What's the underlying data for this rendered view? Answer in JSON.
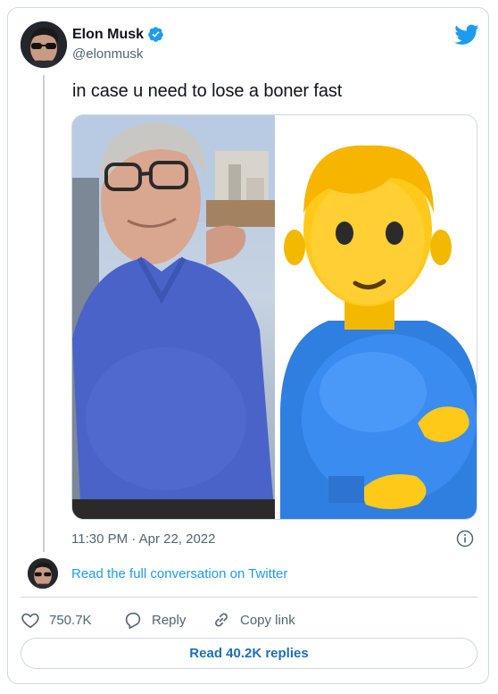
{
  "user": {
    "name": "Elon Musk",
    "handle": "@elonmusk"
  },
  "tweet": {
    "text": "in case u need to lose a boner fast",
    "timestamp": "11:30 PM · Apr 22, 2022"
  },
  "conversation": {
    "link_label": "Read the full conversation on Twitter"
  },
  "actions": {
    "likes": "750.7K",
    "reply_label": "Reply",
    "copy_link_label": "Copy link"
  },
  "replies_button": {
    "label": "Read 40.2K replies"
  },
  "colors": {
    "twitter_blue": "#1d9bf0",
    "text_secondary": "#536471",
    "border": "#cfd9de"
  },
  "icons": [
    "twitter-bird-icon",
    "verified-badge-icon",
    "info-icon",
    "heart-icon",
    "reply-icon",
    "copy-link-icon"
  ]
}
